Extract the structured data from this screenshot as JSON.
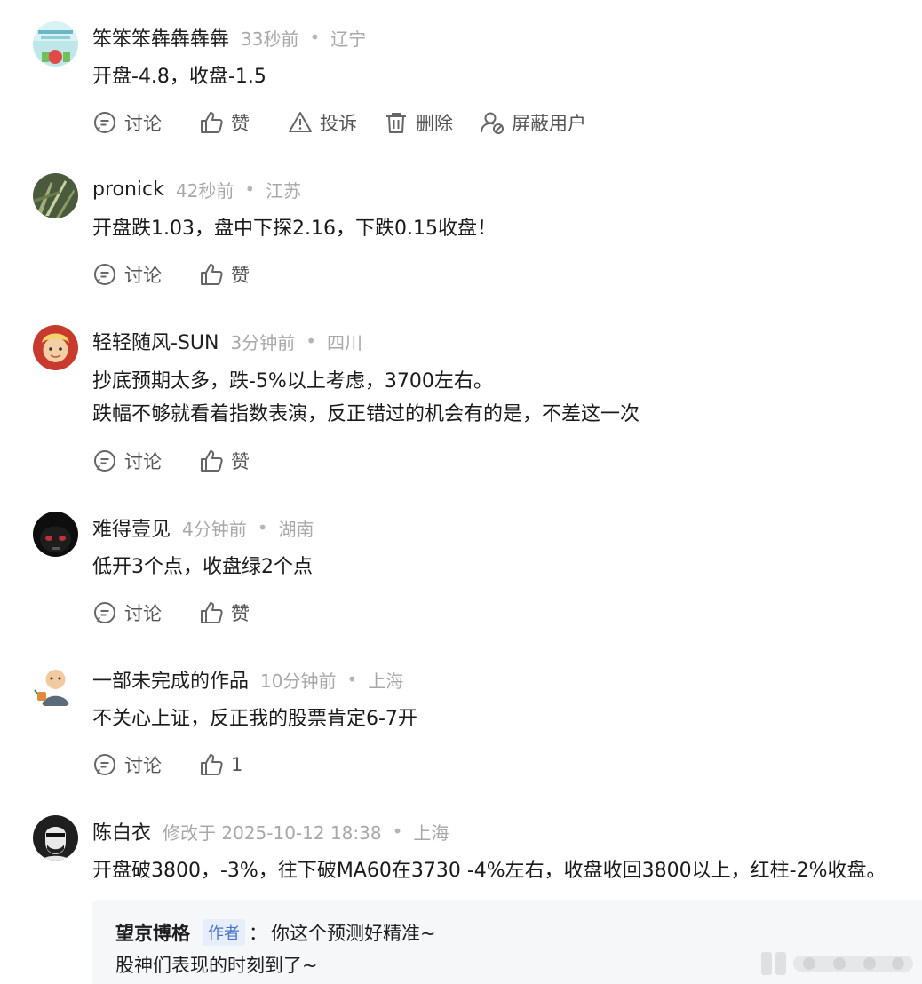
{
  "comments": [
    {
      "username": "笨笨笨犇犇犇犇",
      "time": "33秒前",
      "location": "辽宁",
      "lines": [
        "开盘-4.8，收盘-1.5"
      ],
      "actions": {
        "discuss": "讨论",
        "like": "赞",
        "report": "投诉",
        "delete": "删除",
        "block": "屏蔽用户"
      }
    },
    {
      "username": "pronick",
      "time": "42秒前",
      "location": "江苏",
      "lines": [
        "开盘跌1.03，盘中下探2.16，下跌0.15收盘！"
      ],
      "actions": {
        "discuss": "讨论",
        "like": "赞"
      }
    },
    {
      "username": "轻轻随风-SUN",
      "time": "3分钟前",
      "location": "四川",
      "lines": [
        "抄底预期太多，跌-5%以上考虑，3700左右。",
        "跌幅不够就看着指数表演，反正错过的机会有的是，不差这一次"
      ],
      "actions": {
        "discuss": "讨论",
        "like": "赞"
      }
    },
    {
      "username": "难得壹见",
      "time": "4分钟前",
      "location": "湖南",
      "lines": [
        "低开3个点，收盘绿2个点"
      ],
      "actions": {
        "discuss": "讨论",
        "like": "赞"
      }
    },
    {
      "username": "一部未完成的作品",
      "time": "10分钟前",
      "location": "上海",
      "lines": [
        "不关心上证，反正我的股票肯定6-7开"
      ],
      "actions": {
        "discuss": "讨论",
        "like": "1"
      }
    },
    {
      "username": "陈白衣",
      "time": "修改于 2025-10-12 18:38",
      "location": "上海",
      "lines": [
        "开盘破3800，-3%，往下破MA60在3730 -4%左右，收盘收回3800以上，红柱-2%收盘。"
      ],
      "reply": {
        "name": "望京博格",
        "tag": "作者",
        "colon": "：",
        "line1": "你这个预测好精准~",
        "line2": "股神们表现的时刻到了~"
      }
    }
  ],
  "separator": "•",
  "colors": {
    "secondary": "#a8a8a8",
    "author_tag_bg": "#e7eefb",
    "author_tag_text": "#4a74c9",
    "reply_bg": "#f6f7f9"
  }
}
